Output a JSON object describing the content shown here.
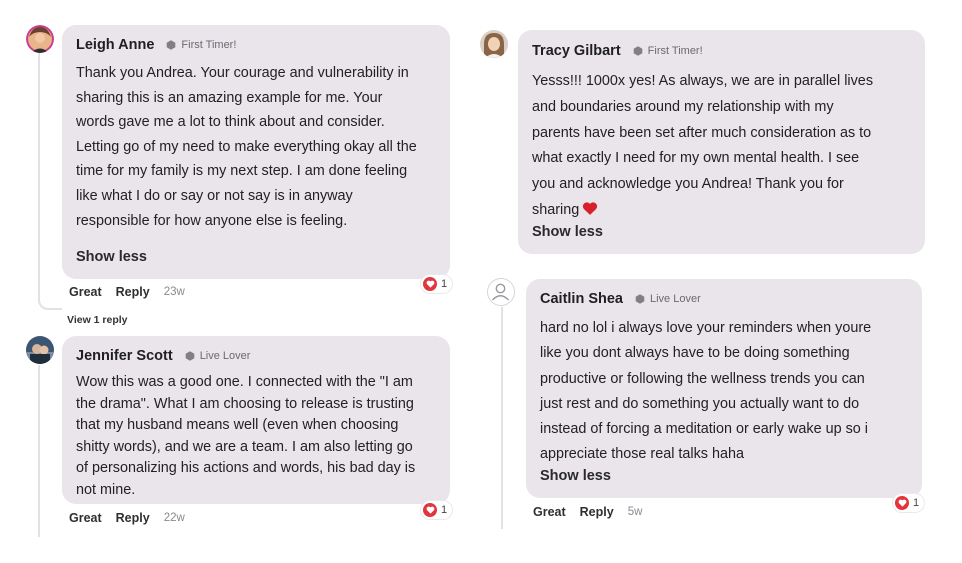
{
  "colors": {
    "bubble": "#e9e5eb",
    "reaction_heart": "#e0363d",
    "thread_line": "#e3e1e6",
    "badge_icon": "#808080"
  },
  "comments": [
    {
      "author": "Leigh Anne",
      "badge": "First Timer!",
      "badge_icon": "hexagon-icon",
      "lines": [
        "Thank you Andrea. Your courage and vulnerability in",
        "sharing this is an amazing example for me. Your",
        "words gave me a lot to think about and consider.",
        "Letting go of my need to make everything okay all the",
        "time for my family is my next step. I am done feeling",
        "like what I do or say or not say is in anyway",
        "responsible for how anyone else is feeling."
      ],
      "show_less": "Show less",
      "actions": {
        "great": "Great",
        "reply": "Reply",
        "time": "23w"
      },
      "reaction": {
        "icon": "heart-icon",
        "count": "1"
      },
      "view_replies": "View 1 reply"
    },
    {
      "author": "Jennifer Scott",
      "badge": "Live Lover",
      "badge_icon": "hexagon-icon",
      "lines": [
        "Wow this was a good one. I connected with the \"I am",
        "the drama\". What I am choosing to release is trusting",
        "that my husband means well (even when choosing",
        "shitty words), and we are a team. I am also letting go",
        "of personalizing his actions and words, his bad day is",
        "not mine."
      ],
      "actions": {
        "great": "Great",
        "reply": "Reply",
        "time": "22w"
      },
      "reaction": {
        "icon": "heart-icon",
        "count": "1"
      }
    },
    {
      "author": "Tracy Gilbart",
      "badge": "First Timer!",
      "badge_icon": "hexagon-icon",
      "lines": [
        "Yesss!!! 1000x yes! As always, we are in parallel lives",
        "and boundaries around my relationship with my",
        "parents have been set after much consideration as to",
        "what exactly I need for my own mental health. I see",
        "you and acknowledge you Andrea! Thank you for",
        "sharing"
      ],
      "trailing_emoji": "red-heart-emoji",
      "show_less": "Show less"
    },
    {
      "author": "Caitlin Shea",
      "badge": "Live Lover",
      "badge_icon": "hexagon-icon",
      "avatar": "default-user-icon",
      "lines": [
        "hard no lol i always love your reminders when youre",
        "like you dont always have to be doing something",
        "productive or following the wellness trends you can",
        "just rest and do something you actually want to do",
        "instead of forcing a meditation or early wake up so i",
        "appreciate those real talks haha"
      ],
      "show_less": "Show less",
      "actions": {
        "great": "Great",
        "reply": "Reply",
        "time": "5w"
      },
      "reaction": {
        "icon": "heart-icon",
        "count": "1"
      }
    }
  ]
}
